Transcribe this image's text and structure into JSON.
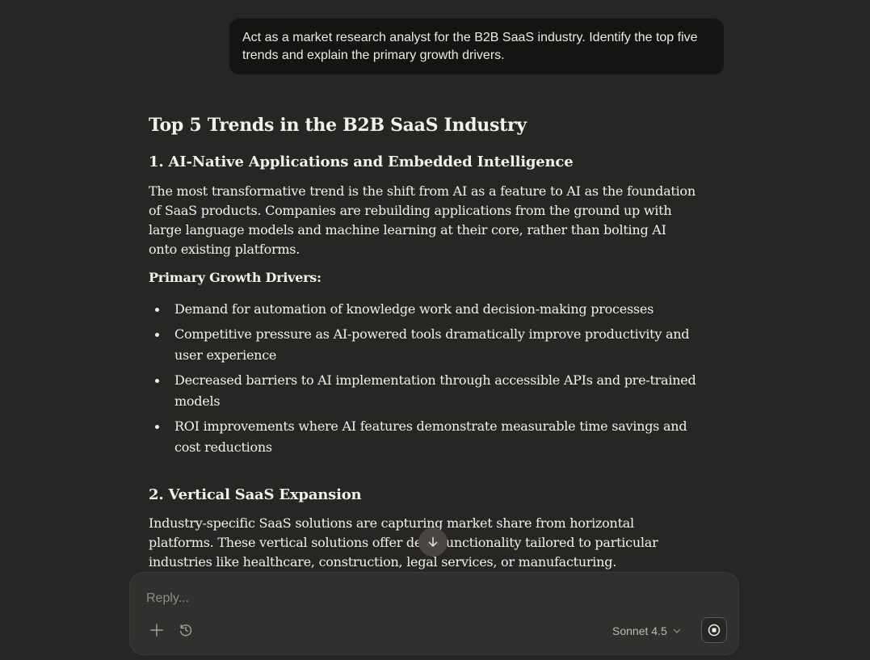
{
  "user_message": "Act as a market research analyst for the B2B SaaS industry. Identify the top five trends and explain the primary growth drivers.",
  "response": {
    "title": "Top 5 Trends in the B2B SaaS Industry",
    "sections": [
      {
        "heading": "1. AI-Native Applications and Embedded Intelligence",
        "paragraph": "The most transformative trend is the shift from AI as a feature to AI as the foundation of SaaS products. Companies are rebuilding applications from the ground up with large language models and machine learning at their core, rather than bolting AI onto existing platforms.",
        "drivers_label": "Primary Growth Drivers:",
        "drivers": [
          "Demand for automation of knowledge work and decision-making processes",
          "Competitive pressure as AI-powered tools dramatically improve productivity and user experience",
          "Decreased barriers to AI implementation through accessible APIs and pre-trained models",
          "ROI improvements where AI features demonstrate measurable time savings and cost reductions"
        ]
      },
      {
        "heading": "2. Vertical SaaS Expansion",
        "paragraph": "Industry-specific SaaS solutions are capturing market share from horizontal platforms. These vertical solutions offer deep functionality tailored to particular industries like healthcare, construction, legal services, or manufacturing."
      }
    ]
  },
  "composer": {
    "placeholder": "Reply...",
    "model": "Sonnet 4.5",
    "add_icon": "plus-icon",
    "history_icon": "clock-history-icon",
    "model_chevron_icon": "chevron-down-icon",
    "stop_icon": "stop-icon"
  },
  "scroll_icon": "arrow-down-icon",
  "colors": {
    "background": "#262624",
    "user_bubble": "#141413",
    "composer": "#30302e",
    "text": "#f2f0ea"
  }
}
